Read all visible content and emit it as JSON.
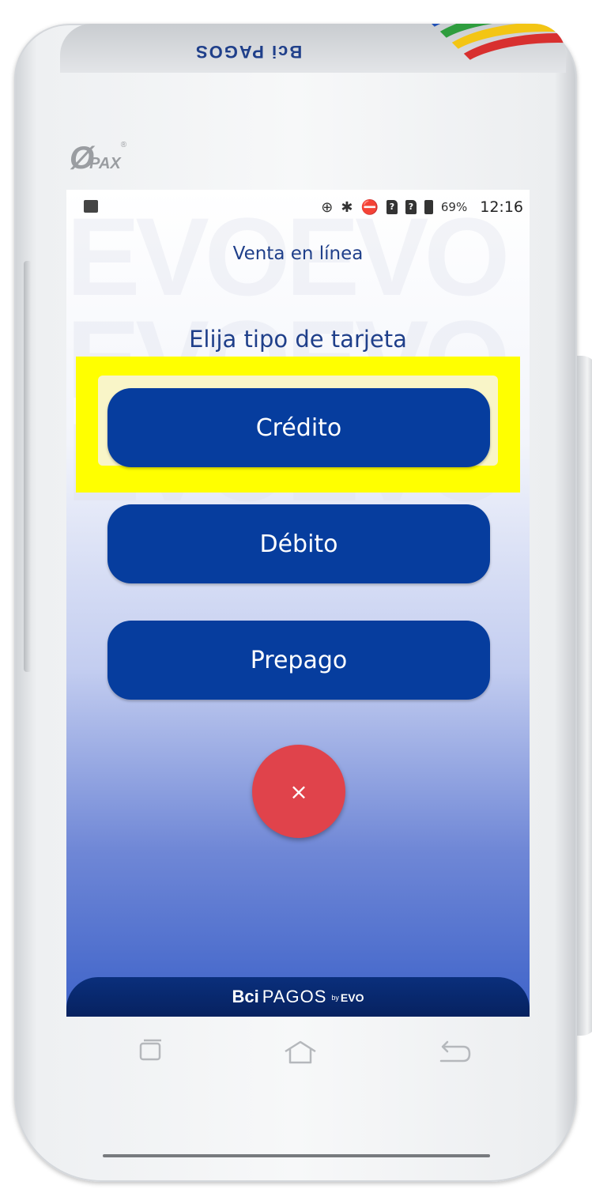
{
  "device": {
    "pax_logo_text": "PAX",
    "printer_label": "Bci PAGOS"
  },
  "status_bar": {
    "battery_percent": "69%",
    "time": "12:16",
    "sim1": "?",
    "sim2": "?"
  },
  "screen": {
    "title": "Venta en línea",
    "prompt": "Elija tipo de tarjeta",
    "buttons": {
      "credito": "Crédito",
      "debito": "Débito",
      "prepago": "Prepago"
    },
    "cancel_label": "×",
    "highlight_color": "#ffff00",
    "button_color": "#063d9e",
    "cancel_color": "#e0434b"
  },
  "footer": {
    "brand_bci": "Bci",
    "brand_pagos": "PAGOS",
    "brand_by": "by",
    "brand_evo": "EVO"
  }
}
